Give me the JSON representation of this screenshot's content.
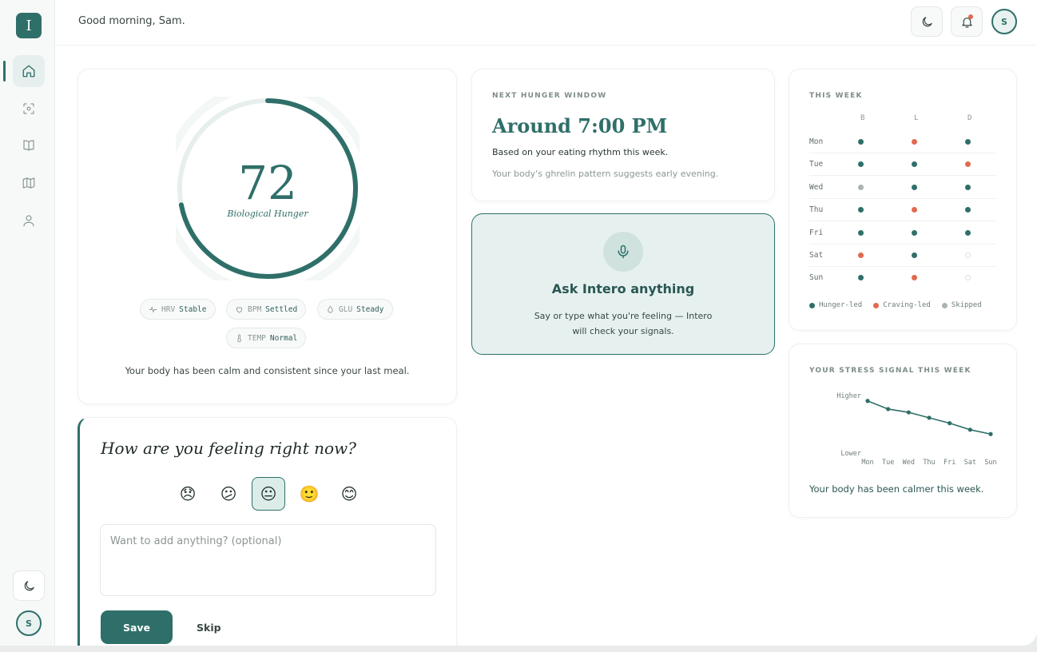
{
  "colors": {
    "brand": "#2f6f69",
    "hunger_led": "#2f6f69",
    "craving_led": "#e06a4f",
    "skipped": "#a9b5b2",
    "empty": "#ffffff"
  },
  "sidebar": {
    "logo_letter": "I",
    "items": [
      {
        "name": "home",
        "icon": "home-icon",
        "active": true
      },
      {
        "name": "scan",
        "icon": "scan-icon",
        "active": false
      },
      {
        "name": "journal",
        "icon": "book-icon",
        "active": false
      },
      {
        "name": "map",
        "icon": "map-icon",
        "active": false
      },
      {
        "name": "profile",
        "icon": "user-icon",
        "active": false
      }
    ],
    "avatar_initial": "S"
  },
  "header": {
    "greeting": "Good morning, Sam.",
    "avatar_initial": "S"
  },
  "hunger": {
    "score": "72",
    "score_fraction": 0.72,
    "label": "Biological Hunger",
    "signals": [
      {
        "key": "HRV",
        "value": "Stable",
        "icon": "pulse-icon"
      },
      {
        "key": "BPM",
        "value": "Settled",
        "icon": "heart-icon"
      },
      {
        "key": "GLU",
        "value": "Steady",
        "icon": "drop-icon"
      },
      {
        "key": "TEMP",
        "value": "Normal",
        "icon": "thermometer-icon"
      }
    ],
    "summary": "Your body has been calm and consistent since your last meal."
  },
  "feeling": {
    "title": "How are you feeling right now?",
    "emojis": [
      "😞",
      "😕",
      "😐",
      "🙂",
      "😊"
    ],
    "selected_index": 2,
    "placeholder": "Want to add anything? (optional)",
    "save_label": "Save",
    "skip_label": "Skip"
  },
  "next_hunger": {
    "label": "NEXT HUNGER WINDOW",
    "time": "Around 7:00 PM",
    "subtitle": "Based on your eating rhythm this week.",
    "note": "Your body's ghrelin pattern suggests early evening."
  },
  "ask": {
    "title": "Ask Intero anything",
    "subtitle": "Say or type what you're feeling — Intero will check your signals."
  },
  "week": {
    "label": "THIS WEEK",
    "columns": [
      "B",
      "L",
      "D"
    ],
    "rows": [
      {
        "day": "Mon",
        "cells": [
          "hunger",
          "craving",
          "hunger"
        ]
      },
      {
        "day": "Tue",
        "cells": [
          "hunger",
          "hunger",
          "craving"
        ]
      },
      {
        "day": "Wed",
        "cells": [
          "skipped",
          "hunger",
          "hunger"
        ]
      },
      {
        "day": "Thu",
        "cells": [
          "hunger",
          "craving",
          "hunger"
        ]
      },
      {
        "day": "Fri",
        "cells": [
          "hunger",
          "hunger",
          "hunger"
        ]
      },
      {
        "day": "Sat",
        "cells": [
          "craving",
          "hunger",
          "empty"
        ]
      },
      {
        "day": "Sun",
        "cells": [
          "hunger",
          "craving",
          "empty"
        ]
      }
    ],
    "legend": {
      "hunger": "Hunger-led",
      "craving": "Craving-led",
      "skipped": "Skipped"
    }
  },
  "stress": {
    "label": "YOUR STRESS SIGNAL THIS WEEK",
    "summary": "Your body has been calmer this week."
  },
  "chart_data": {
    "type": "line",
    "categories": [
      "Mon",
      "Tue",
      "Wed",
      "Thu",
      "Fri",
      "Sat",
      "Sun"
    ],
    "values": [
      0.93,
      0.78,
      0.72,
      0.62,
      0.52,
      0.4,
      0.32
    ],
    "ylim": [
      0,
      1
    ],
    "y_tick_labels": [
      "Lower",
      "Higher"
    ],
    "grid": false
  }
}
